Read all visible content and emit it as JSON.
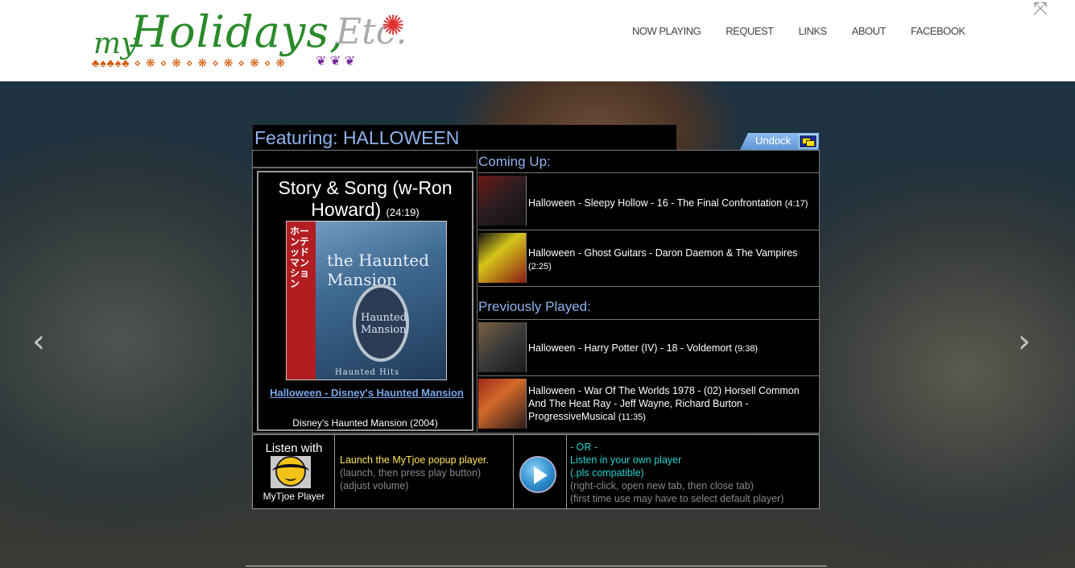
{
  "header": {
    "logo": {
      "my": "my",
      "holidays": "Holidays,",
      "etc": "Etc."
    },
    "nav": [
      "NOW PLAYING",
      "REQUEST",
      "LINKS",
      "ABOUT",
      "FACEBOOK"
    ]
  },
  "player": {
    "featuring": "Featuring: HALLOWEEN",
    "undock_label": "Undock",
    "now_playing": {
      "title": "Story & Song (w-Ron Howard)",
      "duration": "(24:19)",
      "album_link": "Halloween - Disney's Haunted Mansion",
      "album_sub": "Disney's Haunted Mansion (2004)",
      "album_art": {
        "mansion": "the Haunted Mansion",
        "oval": "Haunted Mansion",
        "foot": "Haunted Hits"
      }
    },
    "coming_up_label": "Coming Up:",
    "coming_up": [
      {
        "text": "Halloween - Sleepy Hollow - 16 - The Final Confrontation",
        "duration": "(4:17)"
      },
      {
        "text": "Halloween - Ghost Guitars - Daron Daemon & The Vampires",
        "duration": "(2:25)"
      }
    ],
    "previously_played_label": "Previously Played:",
    "previously_played": [
      {
        "text": "Halloween - Harry Potter (IV) - 18 - Voldemort",
        "duration": "(9:38)"
      },
      {
        "text": "Halloween - War Of The Worlds 1978 - (02) Horsell Common And The Heat Ray - Jeff Wayne, Richard Burton - ProgressiveMusical",
        "duration": "(11:35)"
      }
    ]
  },
  "listen": {
    "listen_with": "Listen with",
    "player_name": "MyTjoe Player",
    "launch": "Launch the MyTjoe popup player.",
    "launch_hint1": "(launch, then press play button)",
    "launch_hint2": "(adjust volume)",
    "or": "- OR -",
    "own_player": "Listen in your own player",
    "pls": "(.pls compatible)",
    "own_hint1": "(right-click, open new tab, then close tab)",
    "own_hint2": "(first time use may have to select default player)"
  }
}
